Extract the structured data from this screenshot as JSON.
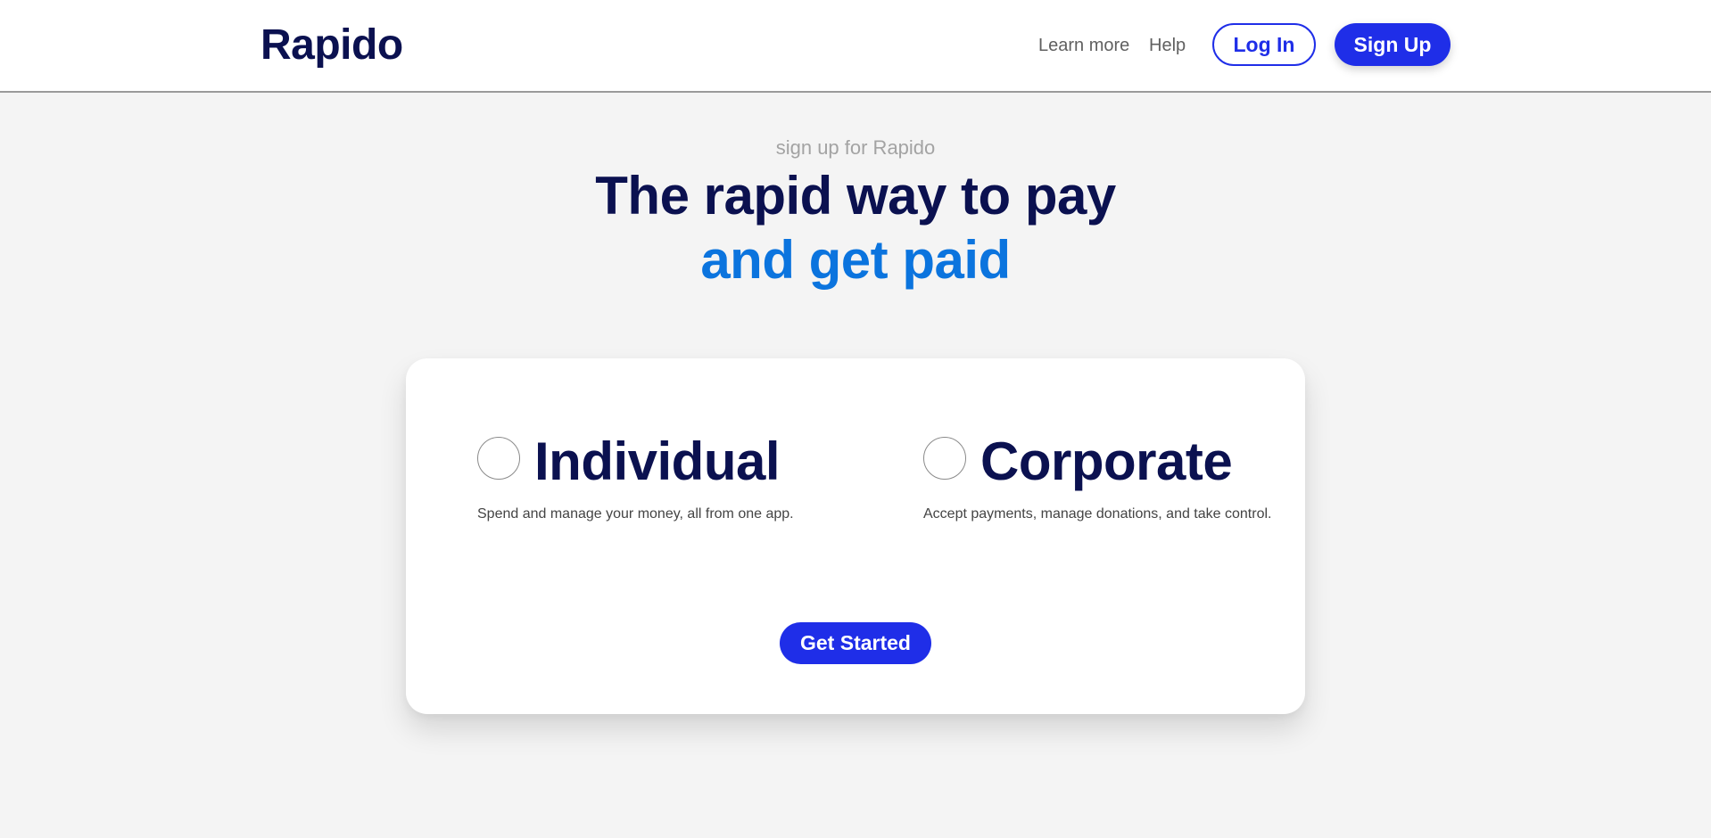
{
  "header": {
    "brand": "Rapido",
    "nav": {
      "learn_more": "Learn more",
      "help": "Help"
    },
    "login_label": "Log In",
    "signup_label": "Sign Up"
  },
  "hero": {
    "subtitle": "sign up for Rapido",
    "title_line1": "The rapid way to pay",
    "title_line2": "and get paid"
  },
  "account_types": [
    {
      "title": "Individual",
      "description": "Spend and manage your money, all from one app.",
      "selected": false
    },
    {
      "title": "Corporate",
      "description": "Accept payments, manage donations, and take control.",
      "selected": false
    }
  ],
  "cta": {
    "get_started_label": "Get Started"
  },
  "colors": {
    "brand_navy": "#0b1150",
    "accent_blue": "#0b74de",
    "button_blue": "#1f2ee8",
    "page_background": "#f4f4f4"
  }
}
